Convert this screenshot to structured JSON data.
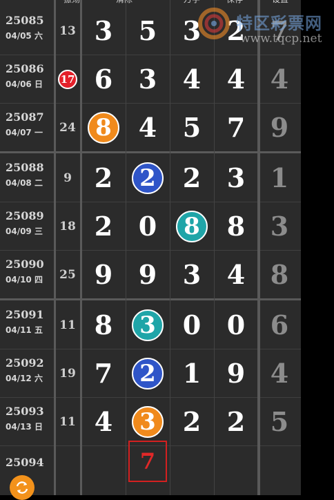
{
  "header": {
    "col_sum": "振荡",
    "col_a": "清除",
    "col_c": "万字",
    "col_d": "保存",
    "col_extra": "设置"
  },
  "watermark": {
    "name": "特区彩票网",
    "url": "www.tqcp.net"
  },
  "rows": [
    {
      "period": "25085",
      "date": "04/05 六",
      "sum": "13",
      "sum_hit": false,
      "nums": [
        {
          "v": "3",
          "ball": null
        },
        {
          "v": "5",
          "ball": null
        },
        {
          "v": "3",
          "ball": null
        },
        {
          "v": "2",
          "ball": null
        }
      ],
      "extra": "7"
    },
    {
      "period": "25086",
      "date": "04/06 日",
      "sum": "17",
      "sum_hit": true,
      "nums": [
        {
          "v": "6",
          "ball": null
        },
        {
          "v": "3",
          "ball": null
        },
        {
          "v": "4",
          "ball": null
        },
        {
          "v": "4",
          "ball": null
        }
      ],
      "extra": "4"
    },
    {
      "period": "25087",
      "date": "04/07 一",
      "sum": "24",
      "sum_hit": false,
      "nums": [
        {
          "v": "8",
          "ball": "orange"
        },
        {
          "v": "4",
          "ball": null
        },
        {
          "v": "5",
          "ball": null
        },
        {
          "v": "7",
          "ball": null
        }
      ],
      "extra": "9"
    },
    {
      "period": "25088",
      "date": "04/08 二",
      "sum": "9",
      "sum_hit": false,
      "nums": [
        {
          "v": "2",
          "ball": null
        },
        {
          "v": "2",
          "ball": "blue"
        },
        {
          "v": "2",
          "ball": null
        },
        {
          "v": "3",
          "ball": null
        }
      ],
      "extra": "1"
    },
    {
      "period": "25089",
      "date": "04/09 三",
      "sum": "18",
      "sum_hit": false,
      "nums": [
        {
          "v": "2",
          "ball": null
        },
        {
          "v": "0",
          "ball": null
        },
        {
          "v": "8",
          "ball": "teal"
        },
        {
          "v": "8",
          "ball": null
        }
      ],
      "extra": "3"
    },
    {
      "period": "25090",
      "date": "04/10 四",
      "sum": "25",
      "sum_hit": false,
      "nums": [
        {
          "v": "9",
          "ball": null
        },
        {
          "v": "9",
          "ball": null
        },
        {
          "v": "3",
          "ball": null
        },
        {
          "v": "4",
          "ball": null
        }
      ],
      "extra": "8"
    },
    {
      "period": "25091",
      "date": "04/11 五",
      "sum": "11",
      "sum_hit": false,
      "nums": [
        {
          "v": "8",
          "ball": null
        },
        {
          "v": "3",
          "ball": "teal"
        },
        {
          "v": "0",
          "ball": null
        },
        {
          "v": "0",
          "ball": null
        }
      ],
      "extra": "6"
    },
    {
      "period": "25092",
      "date": "04/12 六",
      "sum": "19",
      "sum_hit": false,
      "nums": [
        {
          "v": "7",
          "ball": null
        },
        {
          "v": "2",
          "ball": "blue"
        },
        {
          "v": "1",
          "ball": null
        },
        {
          "v": "9",
          "ball": null
        }
      ],
      "extra": "4"
    },
    {
      "period": "25093",
      "date": "04/13 日",
      "sum": "11",
      "sum_hit": false,
      "nums": [
        {
          "v": "4",
          "ball": null
        },
        {
          "v": "3",
          "ball": "orange"
        },
        {
          "v": "2",
          "ball": null
        },
        {
          "v": "2",
          "ball": null
        }
      ],
      "extra": "5"
    }
  ],
  "pending": {
    "period": "25094",
    "selected_value": "7"
  },
  "refresh_icon": "refresh-icon",
  "colors": {
    "orange": "#f08a1c",
    "blue": "#2f55c8",
    "teal": "#1fa5a8",
    "red": "#e4202a"
  }
}
